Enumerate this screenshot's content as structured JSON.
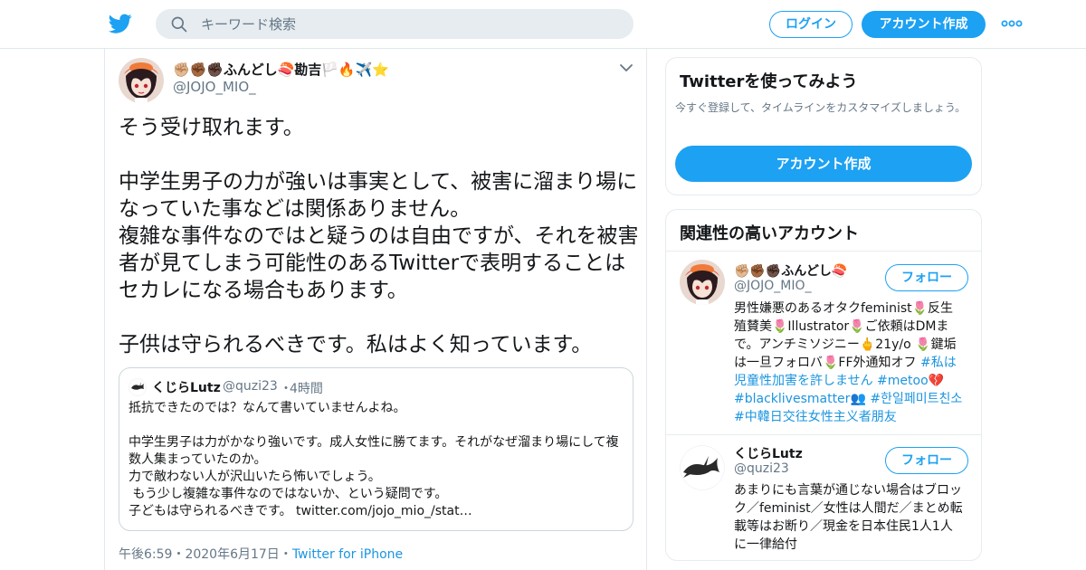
{
  "header": {
    "logo_icon": "twitter-bird-icon",
    "search": {
      "placeholder": "キーワード検索",
      "icon": "search-icon"
    },
    "login_label": "ログイン",
    "signup_label": "アカウント作成",
    "more_icon": "more-dots-icon"
  },
  "tweet": {
    "display_name": "✊🏼✊🏾✊🏿ふんどし🍣勘吉🏳️🔥✈️⭐",
    "handle": "@JOJO_MIO_",
    "text": "そう受け取れます。\n\n中学生男子の力が強いは事実として、被害に溜まり場になっていた事などは関係ありません。\n複雑な事件なのではと疑うのは自由ですが、それを被害者が見てしまう可能性のあるTwitterで表明することはセカレになる場合もあります。\n\n子供は守られるべきです。私はよく知っています。",
    "quote": {
      "name": "くじらLutz",
      "handle": "@quzi23",
      "dot": "・",
      "time": "4時間",
      "text": "抵抗できたのでは？なんて書いていませんよね。\n\n中学生男子は力がかなり強いです。成人女性に勝てます。それがなぜ溜まり場にして複数人集まっていたのか。\n力で敵わない人が沢山いたら怖いでしょう。\n もう少し複雑な事件なのではないか、という疑問です。\n子どもは守られるべきです。 twitter.com/jojo_mio_/stat…"
    },
    "time": "午後6:59",
    "sep1": "・",
    "date": "2020年6月17日",
    "sep2": "・",
    "source": "Twitter for iPhone"
  },
  "signup_card": {
    "title": "Twitterを使ってみよう",
    "desc": "今すぐ登録して、タイムラインをカスタマイズしましょう。",
    "cta_label": "アカウント作成"
  },
  "related": {
    "title": "関連性の高いアカウント",
    "accounts": [
      {
        "name": "✊🏼✊🏾✊🏿ふんどし🍣",
        "handle": "@JOJO_MIO_",
        "follow_label": "フォロー",
        "bio_text": "男性嫌悪のあるオタクfeminist🌷反生殖賛美🌷Illustrator🌷ご依頼はDMまで。アンチミソジニー🖕21y/o 🌷鍵垢は一旦フォロバ🌷FF外通知オフ ",
        "bio_tags": [
          "#私は児童性加害を許しません",
          "#metoo",
          "#blacklivesmatter",
          "#한일페미트친소",
          "#中韓日交往女性主义者朋友"
        ],
        "bio_emoji1": "💔",
        "bio_emoji2": "👥"
      },
      {
        "name": "くじらLutz",
        "handle": "@quzi23",
        "follow_label": "フォロー",
        "bio_text": "あまりにも言葉が通じない場合はブロック／feminist／女性は人間だ／まとめ転載等はお断り／現金を日本住民1人1人に一律給付"
      }
    ]
  },
  "colors": {
    "brand": "#1da1f2",
    "link": "#1b95e0",
    "muted": "#657786",
    "border": "#e1e8ed"
  }
}
